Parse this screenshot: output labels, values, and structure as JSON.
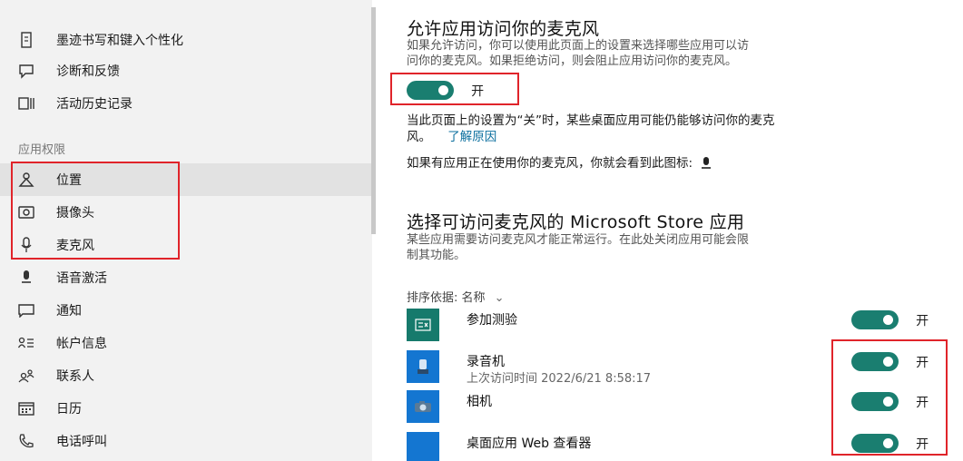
{
  "sidebar": {
    "items_top": [
      {
        "icon": "pen-icon",
        "label": "墨迹书写和键入个性化"
      },
      {
        "icon": "feedback-icon",
        "label": "诊断和反馈"
      },
      {
        "icon": "activity-history-icon",
        "label": "活动历史记录"
      }
    ],
    "section_label": "应用权限",
    "items": [
      {
        "icon": "location-icon",
        "label": "位置"
      },
      {
        "icon": "camera-icon",
        "label": "摄像头"
      },
      {
        "icon": "microphone-icon",
        "label": "麦克风"
      },
      {
        "icon": "voice-activation-icon",
        "label": "语音激活"
      },
      {
        "icon": "notification-icon",
        "label": "通知"
      },
      {
        "icon": "account-info-icon",
        "label": "帐户信息"
      },
      {
        "icon": "contacts-icon",
        "label": "联系人"
      },
      {
        "icon": "calendar-icon",
        "label": "日历"
      },
      {
        "icon": "phone-icon",
        "label": "电话呼叫"
      }
    ]
  },
  "main": {
    "allow_title": "允许应用访问你的麦克风",
    "allow_desc_1": "如果允许访问，你可以使用此页面上的设置来选择哪些应用可以访",
    "allow_desc_2": "问你的麦克风。如果拒绝访问，则会阻止应用访问你的麦克风。",
    "master_toggle_label": "开",
    "note_1": "当此页面上的设置为“关”时，某些桌面应用可能仍能够访问你的麦克",
    "note_2": "风。",
    "learn_why_link": "了解原因",
    "indicator_text": "如果有应用正在使用你的麦克风，你就会看到此图标:",
    "store_title": "选择可访问麦克风的 Microsoft Store 应用",
    "store_desc_1": "某些应用需要访问麦克风才能正常运行。在此处关闭应用可能会限",
    "store_desc_2": "制其功能。",
    "sort_label": "排序依据: 名称",
    "apps": [
      {
        "name": "参加测验",
        "sub": "",
        "icon": "quiz-icon",
        "state": "开"
      },
      {
        "name": "录音机",
        "sub": "上次访问时间 2022/6/21 8:58:17",
        "icon": "recorder-icon",
        "state": "开"
      },
      {
        "name": "相机",
        "sub": "",
        "icon": "camera-app-icon",
        "state": "开"
      },
      {
        "name": "桌面应用 Web 查看器",
        "sub": "",
        "icon": "web-viewer-icon",
        "state": "开"
      }
    ]
  },
  "colors": {
    "toggle_on": "#1a7e70",
    "highlight_box": "#e0242a",
    "app_tile": "#1476d1",
    "link": "#0a6e9e"
  }
}
